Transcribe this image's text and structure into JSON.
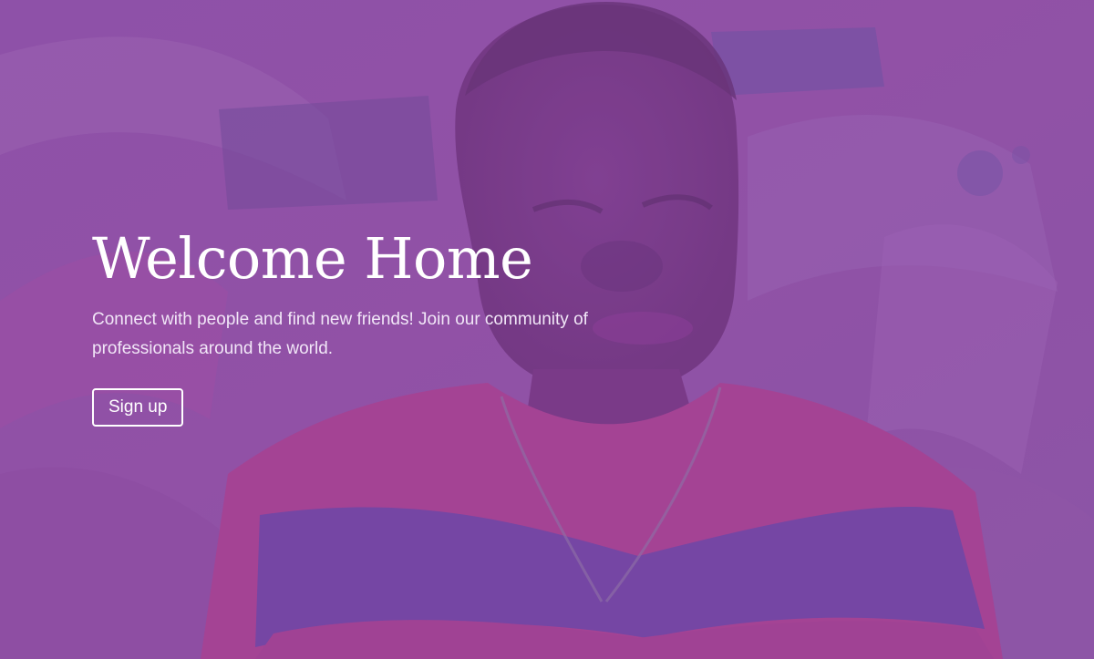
{
  "hero": {
    "title": "Welcome Home",
    "description": "Connect with people and find new friends! Join our community of professionals around the world.",
    "cta_label": "Sign up",
    "overlay_color": "#8e58a6"
  }
}
